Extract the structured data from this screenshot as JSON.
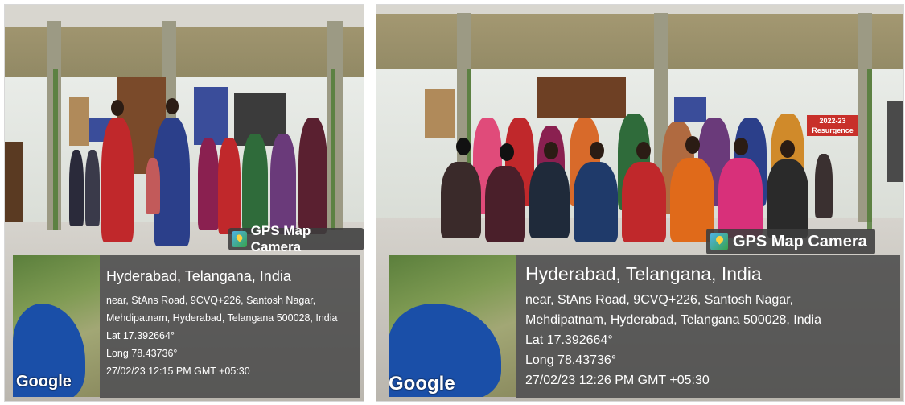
{
  "photos": [
    {
      "badge": "GPS Map Camera",
      "map_brand": "Google",
      "city": "Hyderabad, Telangana, India",
      "address_line1": "near, StAns Road, 9CVQ+226, Santosh Nagar,",
      "address_line2": "Mehdipatnam, Hyderabad, Telangana 500028, India",
      "lat": "Lat 17.392664°",
      "long": "Long 78.43736°",
      "timestamp": "27/02/23 12:15 PM GMT +05:30"
    },
    {
      "badge": "GPS Map Camera",
      "map_brand": "Google",
      "city": "Hyderabad, Telangana, India",
      "address_line1": "near, StAns Road, 9CVQ+226, Santosh Nagar,",
      "address_line2": "Mehdipatnam, Hyderabad, Telangana 500028, India",
      "lat": "Lat 17.392664°",
      "long": "Long 78.43736°",
      "timestamp": "27/02/23 12:26 PM GMT +05:30"
    }
  ],
  "scene_signs": {
    "banner": "2022-23 Resurgence"
  },
  "colors": {
    "saree_palette": [
      "#c0282b",
      "#2b3f8a",
      "#8a2050",
      "#2f6b3a",
      "#d86a2a",
      "#6a1f3a",
      "#e04b7a"
    ]
  }
}
